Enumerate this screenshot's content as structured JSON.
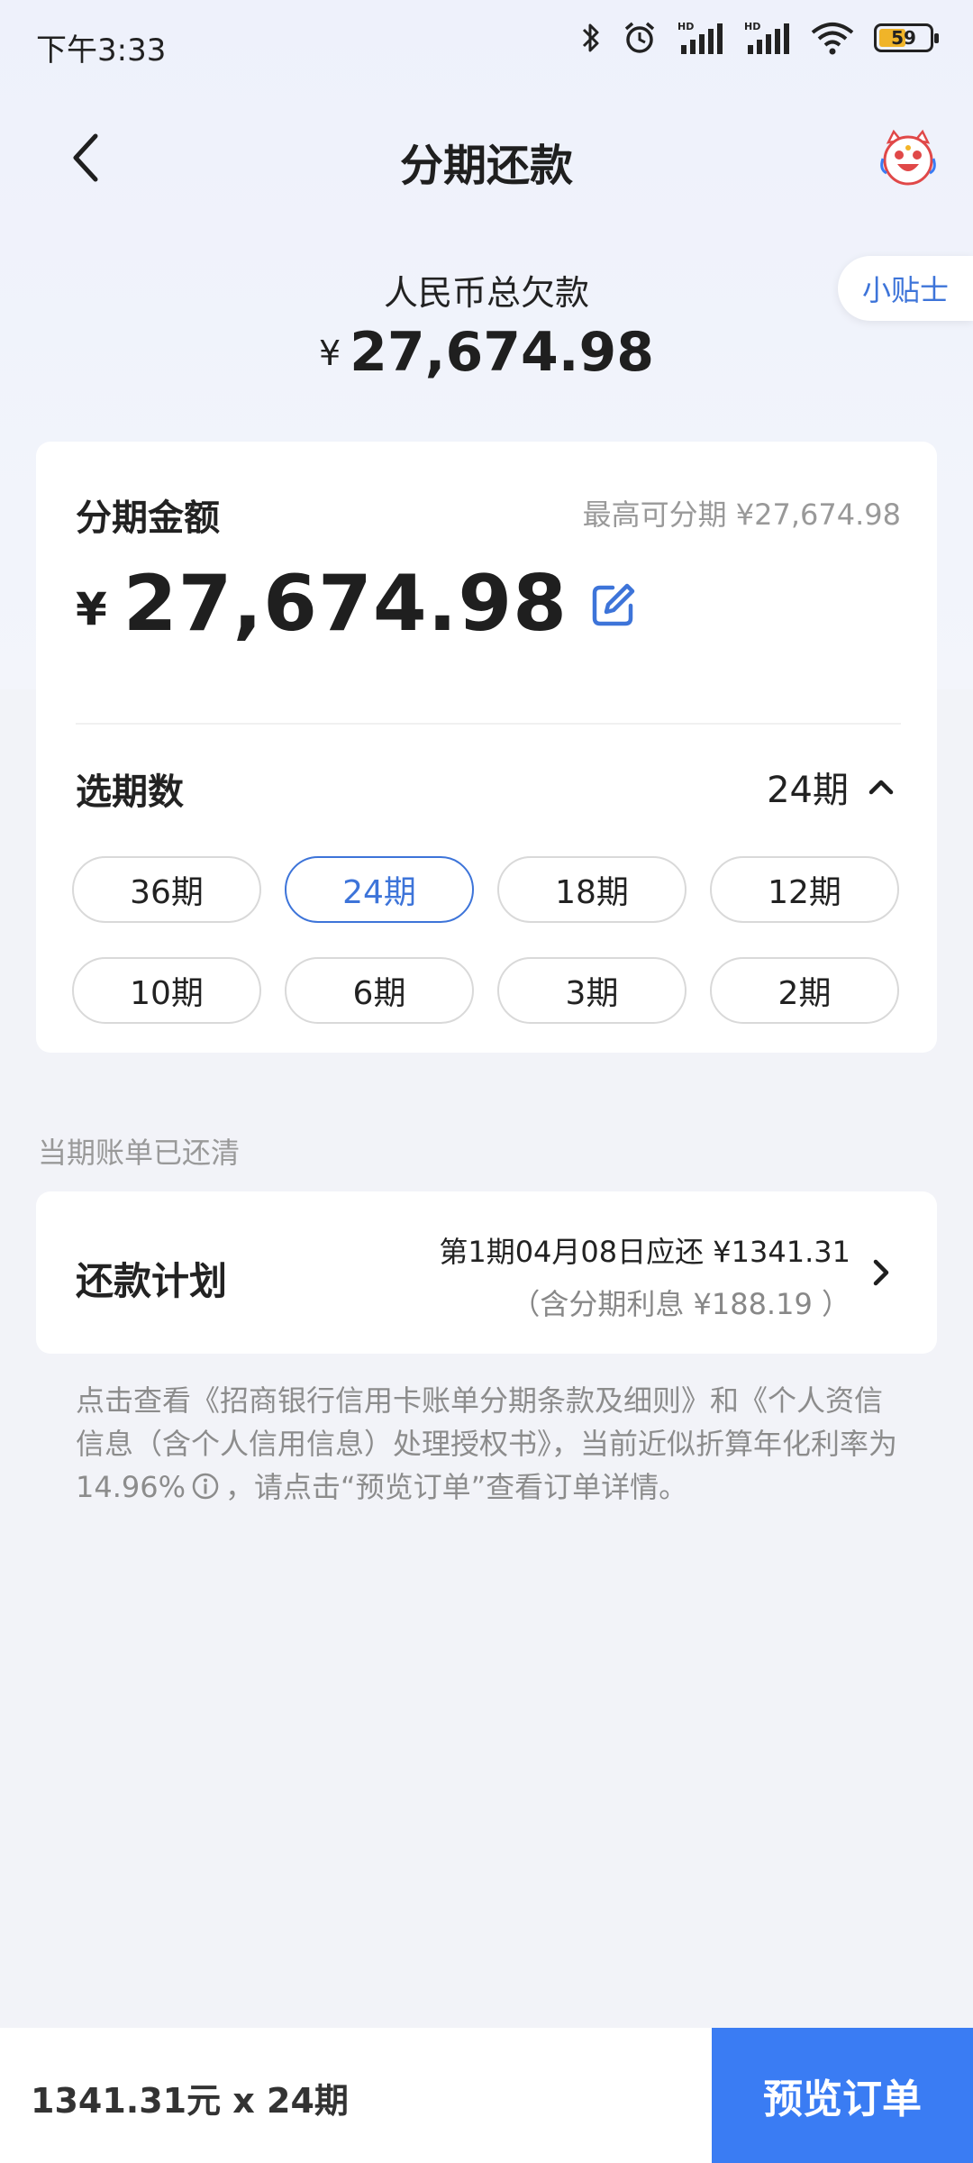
{
  "status_bar": {
    "time": "下午3:33",
    "battery": "59",
    "icons": [
      "bluetooth-icon",
      "alarm-icon",
      "hd-signal-icon",
      "hd-signal-icon",
      "wifi-icon",
      "battery-icon"
    ]
  },
  "header": {
    "title": "分期还款",
    "back_icon": "chevron-left-icon",
    "mascot_icon": "mascot-icon"
  },
  "total": {
    "label": "人民币总欠款",
    "currency": "¥",
    "amount": "27,674.98"
  },
  "tips": {
    "label": "小贴士"
  },
  "installment": {
    "label": "分期金额",
    "max_text": "最高可分期 ¥27,674.98",
    "currency": "¥",
    "amount": "27,674.98",
    "edit_icon": "edit-icon"
  },
  "period": {
    "label": "选期数",
    "selected": "24期",
    "options": [
      {
        "label": "36期",
        "active": false
      },
      {
        "label": "24期",
        "active": true
      },
      {
        "label": "18期",
        "active": false
      },
      {
        "label": "12期",
        "active": false
      },
      {
        "label": "10期",
        "active": false
      },
      {
        "label": "6期",
        "active": false
      },
      {
        "label": "3期",
        "active": false
      },
      {
        "label": "2期",
        "active": false
      }
    ]
  },
  "bill_status": "当期账单已还清",
  "plan": {
    "label": "还款计划",
    "first_payment": "第1期04月08日应还 ¥1341.31",
    "interest": "（含分期利息 ¥188.19 ）"
  },
  "notice": {
    "part1": "点击查看《招商银行信用卡账单分期条款及细则》和《个人资信信息（含个人信用信息）处理授权书》，当前近似折算年化利率为14.96%",
    "part2": "，请点击“预览订单”查看订单详情。"
  },
  "bottom": {
    "summary": "1341.31元 x 24期",
    "button": "预览订单"
  },
  "colors": {
    "accent": "#3d74d9",
    "button_bg": "#3a7cf3",
    "background": "#f2f3f8"
  }
}
